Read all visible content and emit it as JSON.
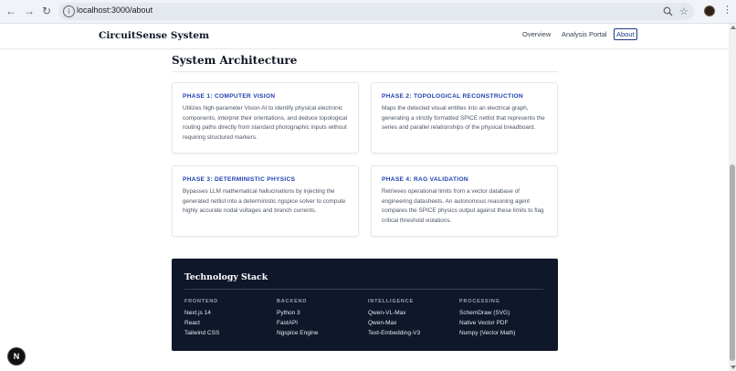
{
  "browser": {
    "url": "localhost:3000/about",
    "icons": [
      "back-arrow-icon",
      "forward-arrow-icon",
      "reload-icon",
      "info-icon",
      "zoom-icon",
      "star-icon",
      "profile-avatar",
      "more-vert-icon"
    ]
  },
  "header": {
    "brand": "CircuitSense System",
    "nav": [
      {
        "label": "Overview"
      },
      {
        "label": "Analysis Portal"
      },
      {
        "label": "About",
        "active": true
      }
    ]
  },
  "architecture": {
    "title": "System Architecture",
    "phases": [
      {
        "title": "PHASE 1: COMPUTER VISION",
        "body": "Utilizes high-parameter Vision AI to identify physical electronic components, interpret their orientations, and deduce topological routing paths directly from standard photographic inputs without requiring structured markers."
      },
      {
        "title": "PHASE 2: TOPOLOGICAL RECONSTRUCTION",
        "body": "Maps the detected visual entities into an electrical graph, generating a strictly formatted SPICE netlist that represents the series and parallel relationships of the physical breadboard."
      },
      {
        "title": "PHASE 3: DETERMINISTIC PHYSICS",
        "body": "Bypasses LLM mathematical hallucinations by injecting the generated netlist into a deterministic ngspice solver to compute highly accurate nodal voltages and branch currents."
      },
      {
        "title": "PHASE 4: RAG VALIDATION",
        "body": "Retrieves operational limits from a vector database of engineering datasheets. An autonomous reasoning agent compares the SPICE physics output against these limits to flag critical threshold violations."
      }
    ]
  },
  "stack": {
    "title": "Technology Stack",
    "columns": [
      {
        "heading": "FRONTEND",
        "items": [
          "Next.js 14",
          "React",
          "Tailwind CSS"
        ]
      },
      {
        "heading": "BACKEND",
        "items": [
          "Python 3",
          "FastAPI",
          "Ngspice Engine"
        ]
      },
      {
        "heading": "INTELLIGENCE",
        "items": [
          "Qwen-VL-Max",
          "Qwen-Max",
          "Text-Embedding-V3"
        ]
      },
      {
        "heading": "PROCESSING",
        "items": [
          "SchemDraw (SVG)",
          "Native Vector PDF",
          "Numpy (Vector Math)"
        ]
      }
    ]
  },
  "badge": {
    "label": "N"
  }
}
